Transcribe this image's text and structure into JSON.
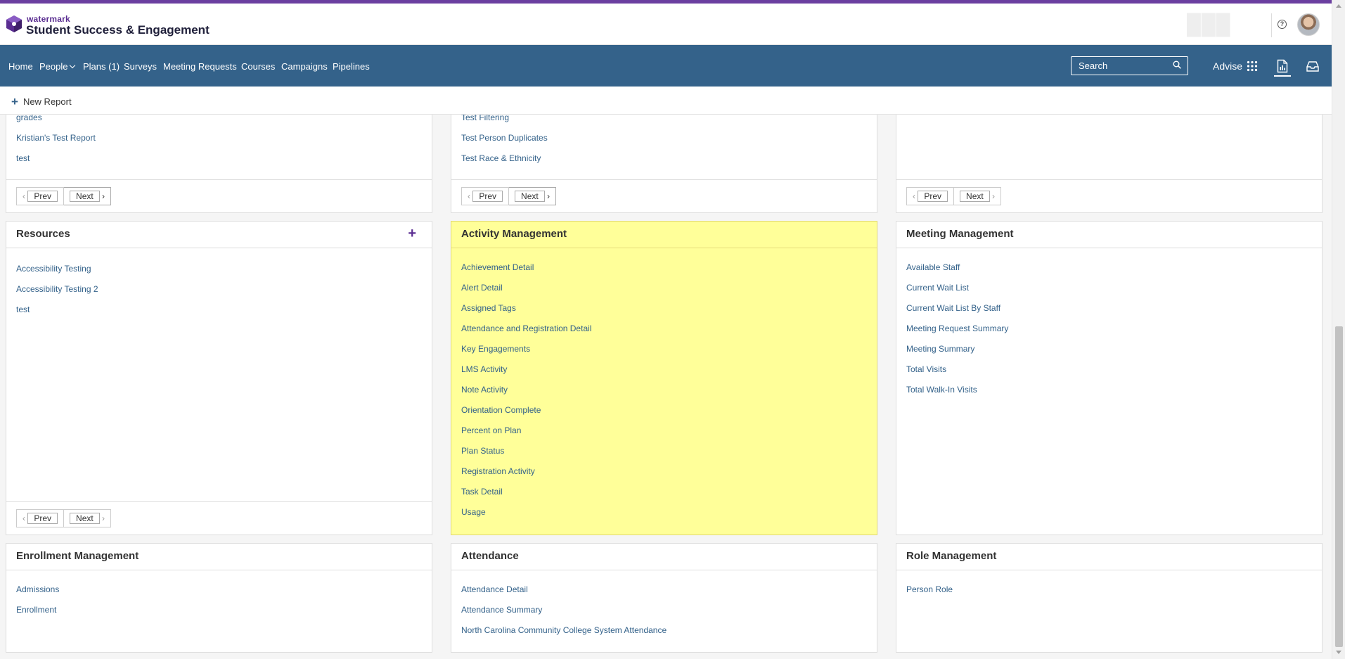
{
  "brand": {
    "small": "watermark",
    "title": "Student Success & Engagement",
    "accent_color": "#6b3fa0",
    "nav_color": "#34628a"
  },
  "header": {
    "help_icon": "question-circle-icon",
    "help_glyph": "?",
    "avatar_icon": "user-avatar"
  },
  "nav": {
    "items": [
      "Home",
      "People",
      "Plans (1)",
      "Surveys",
      "Meeting Requests",
      "Courses",
      "Campaigns",
      "Pipelines"
    ],
    "search_placeholder": "Search",
    "advise_label": "Advise"
  },
  "toolbar": {
    "new_report_plus": "+",
    "new_report_label": "New Report"
  },
  "pager": {
    "prev": "Prev",
    "next": "Next"
  },
  "panels": {
    "top_left": {
      "items": [
        "grades",
        "Kristian's Test Report",
        "test"
      ]
    },
    "top_mid": {
      "items": [
        "Test Filtering",
        "Test Person Duplicates",
        "Test Race & Ethnicity"
      ]
    },
    "top_right": {
      "items": []
    },
    "resources": {
      "title": "Resources",
      "add_glyph": "+",
      "items": [
        "Accessibility Testing",
        "Accessibility Testing 2",
        "test"
      ]
    },
    "activity": {
      "title": "Activity Management",
      "highlight_color": "#ffff99",
      "items": [
        "Achievement Detail",
        "Alert Detail",
        "Assigned Tags",
        "Attendance and Registration Detail",
        "Key Engagements",
        "LMS Activity",
        "Note Activity",
        "Orientation Complete",
        "Percent on Plan",
        "Plan Status",
        "Registration Activity",
        "Task Detail",
        "Usage"
      ]
    },
    "meeting": {
      "title": "Meeting Management",
      "items": [
        "Available Staff",
        "Current Wait List",
        "Current Wait List By Staff",
        "Meeting Request Summary",
        "Meeting Summary",
        "Total Visits",
        "Total Walk-In Visits"
      ]
    },
    "enrollment": {
      "title": "Enrollment Management",
      "items": [
        "Admissions",
        "Enrollment"
      ]
    },
    "attendance": {
      "title": "Attendance",
      "items": [
        "Attendance Detail",
        "Attendance Summary",
        "North Carolina Community College System Attendance"
      ]
    },
    "role": {
      "title": "Role Management",
      "items": [
        "Person Role"
      ]
    }
  }
}
